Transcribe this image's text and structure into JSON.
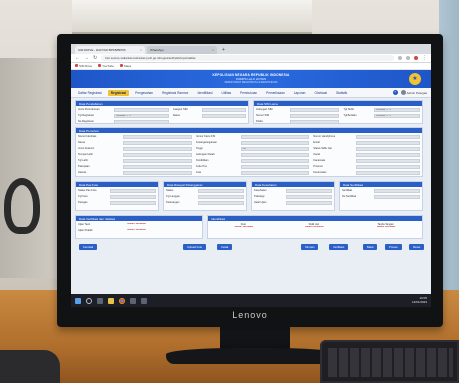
{
  "monitor": {
    "brand": "Lenovo"
  },
  "browser": {
    "tabs": [
      {
        "label": "SIM DRIVE - DAFTAR BPKB/BPKB",
        "active": true
      },
      {
        "label": "WhatsApp",
        "active": false
      }
    ],
    "new_tab": "+",
    "url": "Not secure   satlantas.korlantas.polri.go.id/registrasi/bpkb/input/daftar",
    "bookmarks": [
      "SIM Drive",
      "YouTube",
      "Maps"
    ]
  },
  "app": {
    "banner": {
      "line1": "KEPOLISIAN NEGARA REPUBLIK INDONESIA",
      "line2": "KORPS LALU LINTAS",
      "line3": "DIREKTORAT REGISTRASI & IDENTIFIKASI"
    },
    "menu": [
      {
        "label": "Daftar Registrasi",
        "active": false
      },
      {
        "label": "Registrasi",
        "active": true
      },
      {
        "label": "Pengesahan",
        "active": false
      },
      {
        "label": "Registrasi Ranmor",
        "active": false
      },
      {
        "label": "Identifikasi",
        "active": false
      },
      {
        "label": "Utilitas",
        "active": false
      },
      {
        "label": "Pembukuan",
        "active": false
      },
      {
        "label": "Pemeriksaan",
        "active": false
      },
      {
        "label": "Laporan",
        "active": false
      },
      {
        "label": "Otorisasi",
        "active": false
      },
      {
        "label": "Statistik",
        "active": false
      }
    ],
    "help": "?",
    "user": "Admin Petugas"
  },
  "panels": {
    "pendaftaran": {
      "title": "Data Pendaftaran",
      "fields": [
        {
          "label": "Jenis Permohonan",
          "value": ""
        },
        {
          "label": "Tgl Registrasi",
          "value": "DD/MM/YYYY"
        },
        {
          "label": "No Registrasi",
          "value": ""
        }
      ],
      "fields2": [
        {
          "label": "Kategori SIM",
          "value": ""
        },
        {
          "label": "Status",
          "value": ""
        }
      ]
    },
    "sim_lama": {
      "title": "Data SIM Lama",
      "fields": [
        {
          "label": "Golongan SIM",
          "value": ""
        },
        {
          "label": "Nomor SIM",
          "value": ""
        },
        {
          "label": "Polda",
          "value": ""
        }
      ],
      "fields2": [
        {
          "label": "Tgl Terbit",
          "value": "DD/MM/YYYY"
        },
        {
          "label": "Tgl Berlaku",
          "value": "DD/MM/YYYY"
        }
      ]
    },
    "pemohon": {
      "title": "Data Pemohon",
      "left": [
        {
          "label": "Nomor Identitas",
          "value": ""
        },
        {
          "label": "Nama",
          "value": ""
        },
        {
          "label": "Jenis Kelamin",
          "value": ""
        },
        {
          "label": "Tempat Lahir",
          "value": ""
        },
        {
          "label": "Tgl Lahir",
          "value": ""
        },
        {
          "label": "Pekerjaan",
          "value": ""
        },
        {
          "label": "Alamat",
          "value": ""
        }
      ],
      "mid": [
        {
          "label": "Nomor Kartu KIS",
          "value": ""
        },
        {
          "label": "Kewarganegaraan",
          "value": ""
        },
        {
          "label": "Tinggi",
          "value": "cm"
        },
        {
          "label": "Golongan Darah",
          "value": ""
        },
        {
          "label": "Pendidikan",
          "value": ""
        },
        {
          "label": "Kode Pos",
          "value": ""
        },
        {
          "label": "Kota",
          "value": ""
        }
      ],
      "right": [
        {
          "label": "Nomor Handphone",
          "value": ""
        },
        {
          "label": "Email",
          "value": ""
        },
        {
          "label": "Status Sidik Jari",
          "value": ""
        },
        {
          "label": "Cacat",
          "value": ""
        },
        {
          "label": "Kacamata",
          "value": ""
        },
        {
          "label": "Provinsi",
          "value": ""
        },
        {
          "label": "Kecamatan",
          "value": ""
        }
      ]
    },
    "pas_foto": {
      "title": "Data Pas Foto",
      "fields": [
        {
          "label": "Status Pas Foto",
          "value": ""
        },
        {
          "label": "Tgl Foto",
          "value": ""
        },
        {
          "label": "Petugas",
          "value": ""
        }
      ]
    },
    "riwayat": {
      "title": "Data Riwayat Pelanggaran",
      "fields": [
        {
          "label": "Status",
          "value": ""
        },
        {
          "label": "Tgl Langgar",
          "value": ""
        },
        {
          "label": "Keterangan",
          "value": ""
        }
      ]
    },
    "kesehatan": {
      "title": "Data Kesehatan",
      "fields": [
        {
          "label": "Kesehatan",
          "value": ""
        },
        {
          "label": "Psikologi",
          "value": ""
        },
        {
          "label": "Hasil Ujian",
          "value": ""
        }
      ]
    },
    "sertifikasi": {
      "title": "Data Sertifikasi",
      "fields": [
        {
          "label": "Sertifikat",
          "value": ""
        },
        {
          "label": "No Sertifikat",
          "value": ""
        }
      ]
    },
    "ujian": {
      "title": "Data Verifikasi dan Validasi",
      "fields": [
        {
          "label": "Ujian Teori",
          "value": "Belum Verifikasi"
        },
        {
          "label": "Ujian Praktik",
          "value": "Belum Verifikasi"
        }
      ]
    },
    "identifikasi": {
      "title": "Identifikasi",
      "cols": [
        {
          "label": "Foto",
          "value": "Belum Verifikasi"
        },
        {
          "label": "Sidik Jari",
          "value": "Belum Verifikasi"
        },
        {
          "label": "Tanda Tangan",
          "value": "Belum Verifikasi"
        }
      ]
    }
  },
  "buttons": {
    "kembali": "Kembali",
    "upload_foto": "Upload Foto",
    "cetak": "Cetak",
    "simpan": "Simpan",
    "verifikasi": "Verifikasi",
    "batal": "Batal",
    "proses": "Proses",
    "reset": "Reset"
  },
  "taskbar": {
    "time": "10:05",
    "date": "12/01/2023"
  }
}
